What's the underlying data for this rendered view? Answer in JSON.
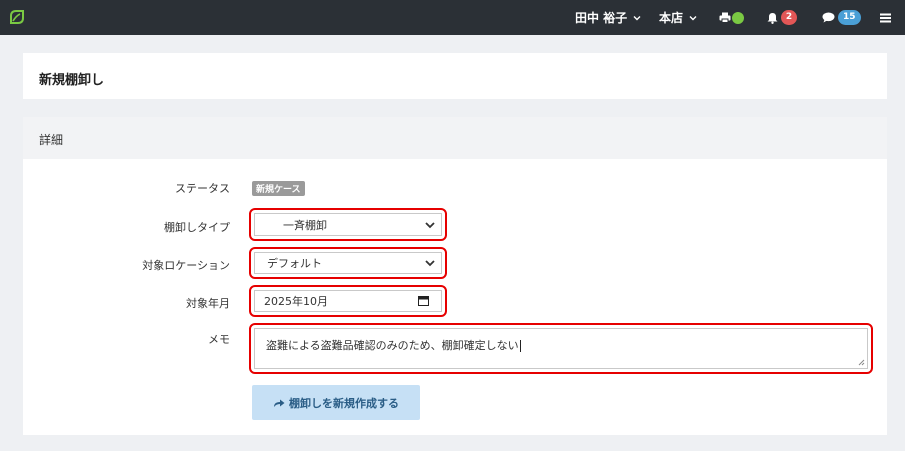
{
  "header": {
    "user_name": "田中 裕子",
    "store_name": "本店",
    "notification_count": "2",
    "message_count": "15",
    "printer_status_color": "#7ac943"
  },
  "page": {
    "title": "新規棚卸し"
  },
  "detail": {
    "section_title": "詳細",
    "status_label": "ステータス",
    "status_badge": "新規ケース",
    "type_label": "棚卸しタイプ",
    "type_value": "一斉棚卸",
    "location_label": "対象ロケーション",
    "location_value": "デフォルト",
    "month_label": "対象年月",
    "month_value": "2025年10月",
    "memo_label": "メモ",
    "memo_value": "盗難による盗難品確認のみのため、棚卸確定しない",
    "submit_label": "棚卸しを新規作成する"
  },
  "icons": {
    "logo": "leaf-logo-icon",
    "user_menu": "chevron-down-icon",
    "store_menu": "chevron-down-icon",
    "printer": "printer-icon",
    "notifications": "bell-icon",
    "messages": "comment-icon",
    "menu": "hamburger-menu-icon",
    "submit": "share-arrow-icon",
    "calendar": "calendar-icon"
  },
  "colors": {
    "topbar": "#2b3036",
    "highlight": "#e60000",
    "notification_badge": "#e25656",
    "message_badge": "#4a9fd6",
    "submit_button": "#c6e0f5"
  }
}
